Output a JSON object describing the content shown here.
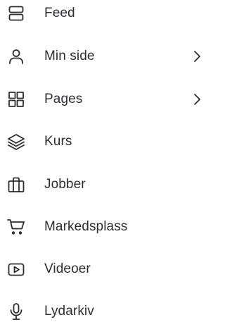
{
  "menu": {
    "items": [
      {
        "label": "Feed",
        "icon": "server-stack-icon",
        "has_submenu": false
      },
      {
        "label": "Min side",
        "icon": "user-icon",
        "has_submenu": true
      },
      {
        "label": "Pages",
        "icon": "grid-icon",
        "has_submenu": true
      },
      {
        "label": "Kurs",
        "icon": "layers-icon",
        "has_submenu": false
      },
      {
        "label": "Jobber",
        "icon": "briefcase-icon",
        "has_submenu": false
      },
      {
        "label": "Markedsplass",
        "icon": "shopping-cart-icon",
        "has_submenu": false
      },
      {
        "label": "Videoer",
        "icon": "video-play-icon",
        "has_submenu": false
      },
      {
        "label": "Lydarkiv",
        "icon": "microphone-icon",
        "has_submenu": false
      }
    ]
  },
  "colors": {
    "text": "#2b2f33",
    "background": "#ffffff"
  }
}
